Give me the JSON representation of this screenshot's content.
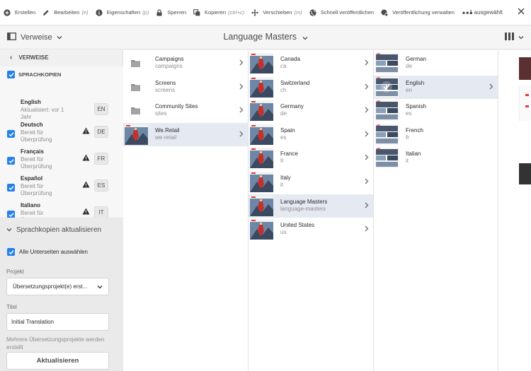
{
  "toolbar": {
    "actions": [
      {
        "label": "Erstellen",
        "shortcut": "",
        "icon": "add-circle-icon"
      },
      {
        "label": "Bearbeiten",
        "shortcut": "(e)",
        "icon": "edit-pencil-icon"
      },
      {
        "label": "Eigenschaften",
        "shortcut": "(p)",
        "icon": "info-icon"
      },
      {
        "label": "Sperren",
        "shortcut": "",
        "icon": "lock-icon"
      },
      {
        "label": "Kopieren",
        "shortcut": "(ctrl+c)",
        "icon": "copy-icon"
      },
      {
        "label": "Verschieben",
        "shortcut": "(m)",
        "icon": "move-icon"
      },
      {
        "label": "Schnell veröffentlichen",
        "shortcut": "",
        "icon": "globe-icon"
      },
      {
        "label": "Veröffentlichung verwalten",
        "shortcut": "",
        "icon": "globe-manage-icon"
      }
    ],
    "more": "•••",
    "selection_count": "1 ausgewählt"
  },
  "titlebar": {
    "rail_label": "Verweise",
    "page_title": "Language Masters"
  },
  "rail": {
    "back_label": "VERWEISE",
    "section_label": "SPRACHKOPIEN",
    "languages": [
      {
        "name": "English",
        "status": "Aktualisiert: vor 1 Jahr",
        "code": "EN",
        "checked": false,
        "warning": false
      },
      {
        "name": "Deutsch",
        "status": "Bereit für Überprüfung",
        "code": "DE",
        "checked": true,
        "warning": true
      },
      {
        "name": "Français",
        "status": "Bereit für Überprüfung",
        "code": "FR",
        "checked": true,
        "warning": true
      },
      {
        "name": "Español",
        "status": "Bereit für Überprüfung",
        "code": "ES",
        "checked": true,
        "warning": true
      },
      {
        "name": "Italiano",
        "status": "Bereit für Überprüfung",
        "code": "IT",
        "checked": true,
        "warning": true
      }
    ],
    "update": {
      "heading": "Sprachkopien aktualisieren",
      "select_all_label": "Alle Unterseiten auswählen",
      "project_label": "Projekt",
      "project_value": "Übersetzungsprojekt(e) erst...",
      "title_label": "Titel",
      "title_value": "Initial Translation",
      "hint": "Mehrere Übersetzungsprojekte werden erstellt",
      "button": "Aktualisieren"
    }
  },
  "columns": [
    {
      "items": [
        {
          "title": "Campaigns",
          "sub": "campaigns",
          "kind": "folder",
          "selected": false
        },
        {
          "title": "Screens",
          "sub": "screens",
          "kind": "folder",
          "selected": false
        },
        {
          "title": "Community Sites",
          "sub": "sites",
          "kind": "folder",
          "selected": false
        },
        {
          "title": "We.Retail",
          "sub": "we-retail",
          "kind": "page",
          "selected": true
        }
      ]
    },
    {
      "items": [
        {
          "title": "Canada",
          "sub": "ca",
          "kind": "page",
          "selected": false
        },
        {
          "title": "Switzerland",
          "sub": "ch",
          "kind": "page",
          "selected": false
        },
        {
          "title": "Germany",
          "sub": "de",
          "kind": "page",
          "selected": false
        },
        {
          "title": "Spain",
          "sub": "es",
          "kind": "page",
          "selected": false
        },
        {
          "title": "France",
          "sub": "fr",
          "kind": "page",
          "selected": false
        },
        {
          "title": "Italy",
          "sub": "it",
          "kind": "page",
          "selected": false
        },
        {
          "title": "Language Masters",
          "sub": "language-masters",
          "kind": "page",
          "selected": true
        },
        {
          "title": "United States",
          "sub": "us",
          "kind": "page",
          "selected": false
        }
      ]
    },
    {
      "items": [
        {
          "title": "German",
          "sub": "de",
          "kind": "page",
          "selected": false
        },
        {
          "title": "English",
          "sub": "en",
          "kind": "page",
          "selected": true,
          "checked": true
        },
        {
          "title": "Spanish",
          "sub": "es",
          "kind": "page",
          "selected": false
        },
        {
          "title": "French",
          "sub": "fr",
          "kind": "page",
          "selected": false
        },
        {
          "title": "Italian",
          "sub": "it",
          "kind": "page",
          "selected": false
        }
      ]
    }
  ],
  "colors": {
    "accent": "#2680eb",
    "selected_row": "#e5e9f1",
    "warning": "#2c2c2c"
  }
}
